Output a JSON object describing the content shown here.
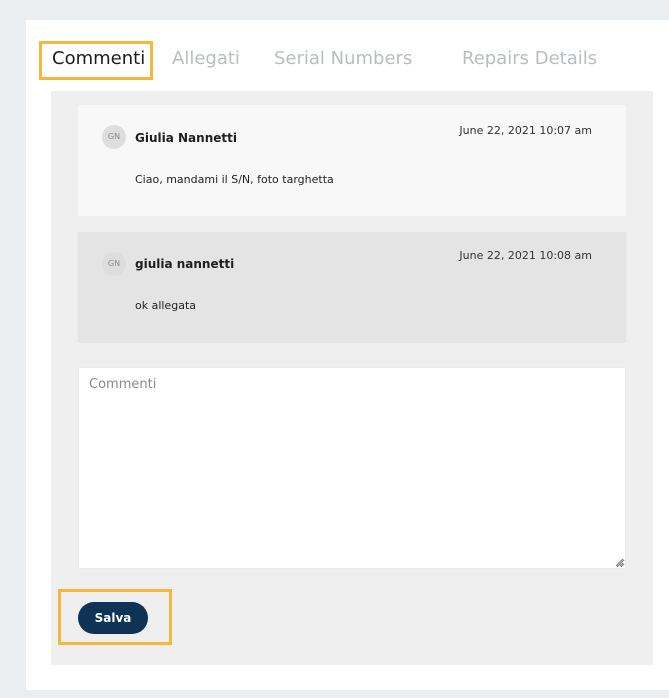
{
  "tabs": [
    {
      "label": "Commenti",
      "active": true
    },
    {
      "label": "Allegati",
      "active": false
    },
    {
      "label": "Serial Numbers",
      "active": false
    },
    {
      "label": "Repairs Details",
      "active": false
    }
  ],
  "comments": [
    {
      "initials": "GN",
      "author": "Giulia Nannetti",
      "date": "June 22, 2021 10:07 am",
      "text": "Ciao, mandami il S/N, foto targhetta"
    },
    {
      "initials": "GN",
      "author": "giulia nannetti",
      "date": "June 22, 2021 10:08 am",
      "text": "ok allegata"
    }
  ],
  "form": {
    "placeholder": "Commenti",
    "value": "",
    "save_label": "Salva"
  },
  "colors": {
    "highlight": "#f5b83d",
    "save_button": "#0e3355",
    "active_tab": "#1c1c1c",
    "inactive_tab": "#b9bdc2"
  }
}
